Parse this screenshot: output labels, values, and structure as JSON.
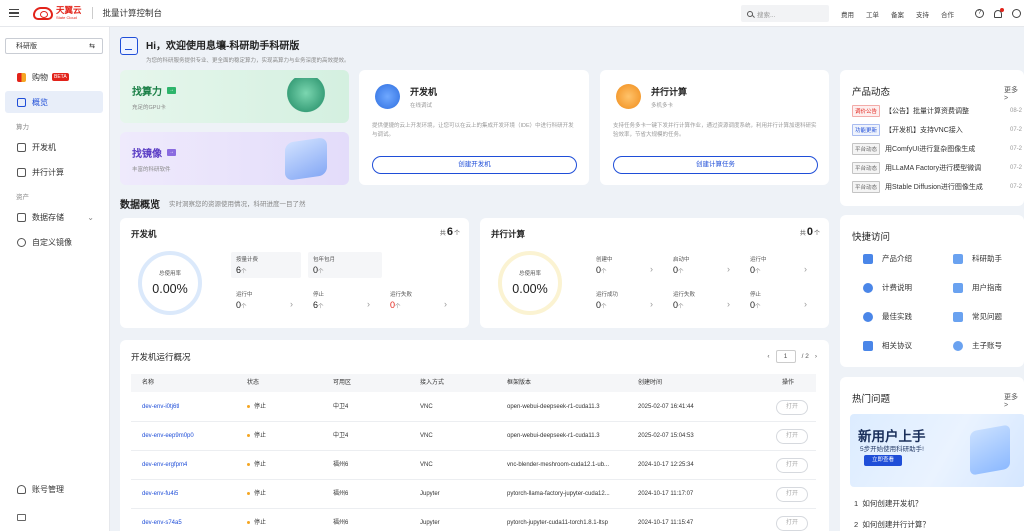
{
  "topbar": {
    "logo_name": "天翼云",
    "logo_sub": "State Cloud",
    "console_title": "批量计算控制台",
    "search_placeholder": "搜索...",
    "nav": [
      "费用",
      "工单",
      "备案",
      "支持",
      "合作"
    ]
  },
  "sidebar": {
    "region": "科研版",
    "items": [
      {
        "label": "购物",
        "badge": "BETA"
      },
      {
        "label": "概览"
      },
      {
        "label": "开发机"
      },
      {
        "label": "并行计算"
      },
      {
        "label": "数据存储"
      },
      {
        "label": "自定义镜像"
      },
      {
        "label": "账号管理"
      }
    ],
    "sections": [
      "算力",
      "资产"
    ]
  },
  "welcome": {
    "title": "Hi，欢迎使用息壤-科研助手科研版",
    "subtitle": "为您的科研服务提供专业、更全面的稳定算力，实现高算力与业务深度的高效提效。"
  },
  "promos": [
    {
      "title": "找算力",
      "desc": "充足的GPU卡"
    },
    {
      "title": "找镜像",
      "desc": "丰富的科研软件"
    }
  ],
  "services": [
    {
      "title": "开发机",
      "subtitle": "在线调试",
      "desc": "提供便捷的云上开发环境，让您可以在云上的集成开发环境（IDE）中进行科研开发与调试。",
      "button": "创建开发机"
    },
    {
      "title": "并行计算",
      "subtitle": "多机多卡",
      "desc": "支持任务多卡一键下发并行计算作业，通过资源调度系统，利用并行计算加速科研实验效率，节省大规模的任务。",
      "button": "创建计算任务"
    }
  ],
  "overview": {
    "title": "数据概览",
    "subtitle": "实时洞察您的资源使用情况，科研进度一目了然"
  },
  "dev_card": {
    "title": "开发机",
    "total_prefix": "共",
    "total": "6",
    "total_unit": "个",
    "ring_label": "总使用率",
    "ring_value": "0.00%",
    "ring_color": "#dbe9fb",
    "stats": [
      {
        "label": "按量计费",
        "value": "6",
        "unit": "个"
      },
      {
        "label": "包年包月",
        "value": "0",
        "unit": "个"
      },
      {
        "label": "运行中",
        "value": "0",
        "unit": "个"
      },
      {
        "label": "停止",
        "value": "6",
        "unit": "个"
      },
      {
        "label": "运行失败",
        "value": "0",
        "unit": "个"
      }
    ]
  },
  "par_card": {
    "title": "并行计算",
    "total_prefix": "共",
    "total": "0",
    "total_unit": "个",
    "ring_label": "总使用率",
    "ring_value": "0.00%",
    "ring_color": "#fbf3d2",
    "stats": [
      {
        "label": "创建中",
        "value": "0",
        "unit": "个"
      },
      {
        "label": "启动中",
        "value": "0",
        "unit": "个"
      },
      {
        "label": "运行中",
        "value": "0",
        "unit": "个"
      },
      {
        "label": "运行成功",
        "value": "0",
        "unit": "个"
      },
      {
        "label": "运行失败",
        "value": "0",
        "unit": "个"
      },
      {
        "label": "停止",
        "value": "0",
        "unit": "个"
      }
    ]
  },
  "dev_table": {
    "title": "开发机运行概况",
    "page": "1",
    "total_pages": "/ 2",
    "columns": [
      "名称",
      "状态",
      "可用区",
      "接入方式",
      "框架版本",
      "创建时间",
      "操作"
    ],
    "rows": [
      {
        "name": "dev-env-i0tj6tl",
        "status": "停止",
        "zone": "中卫4",
        "access": "VNC",
        "framework": "open-webui-deepseek-r1-cuda11.3",
        "created": "2025-02-07 16:41:44",
        "action": "打开"
      },
      {
        "name": "dev-env-eep9m0p0",
        "status": "停止",
        "zone": "中卫4",
        "access": "VNC",
        "framework": "open-webui-deepseek-r1-cuda11.3",
        "created": "2025-02-07 15:04:53",
        "action": "打开"
      },
      {
        "name": "dev-env-ergfpm4",
        "status": "停止",
        "zone": "福州6",
        "access": "VNC",
        "framework": "vnc-blender-meshroom-cuda12.1-ub...",
        "created": "2024-10-17 12:25:34",
        "action": "打开"
      },
      {
        "name": "dev-env-fu4i5",
        "status": "停止",
        "zone": "福州6",
        "access": "Jupyter",
        "framework": "pytorch-llama-factory-jupyter-cuda12...",
        "created": "2024-10-17 11:17:07",
        "action": "打开"
      },
      {
        "name": "dev-env-s74a5",
        "status": "停止",
        "zone": "福州6",
        "access": "Jupyter",
        "framework": "pytorch-jupyter-cuda11-torch1.8.1-ltsp",
        "created": "2024-10-17 11:15:47",
        "action": "打开"
      }
    ]
  },
  "news": {
    "title": "产品动态",
    "more": "更多 >",
    "items": [
      {
        "tag": "调价公告",
        "tag_color": "#e2231a",
        "text": "【公告】批量计算资费调整",
        "date": "08-2"
      },
      {
        "tag": "功能更新",
        "tag_color": "#1f4ed8",
        "text": "【开发机】支持VNC接入",
        "date": "07-2"
      },
      {
        "tag": "平台动态",
        "tag_color": "#666666",
        "text": "用ComfyUI进行复杂图像生成",
        "date": "07-2"
      },
      {
        "tag": "平台动态",
        "tag_color": "#666666",
        "text": "用LLaMA Factory进行模型微调",
        "date": "07-2"
      },
      {
        "tag": "平台动态",
        "tag_color": "#666666",
        "text": "用Stable Diffusion进行图像生成",
        "date": "07-2"
      }
    ]
  },
  "quick": {
    "title": "快捷访问",
    "items": [
      "产品介绍",
      "科研助手",
      "计费说明",
      "用户指南",
      "最佳实践",
      "常见问题",
      "相关协议",
      "主子账号"
    ]
  },
  "faq": {
    "title": "热门问题",
    "more": "更多 >",
    "banner_title": "新用户上手",
    "banner_sub": "5步开始使用科研助手!",
    "banner_btn": "立即查看",
    "items": [
      {
        "no": "1",
        "text": "如何创建开发机？"
      },
      {
        "no": "2",
        "text": "如何创建并行计算？"
      }
    ]
  }
}
